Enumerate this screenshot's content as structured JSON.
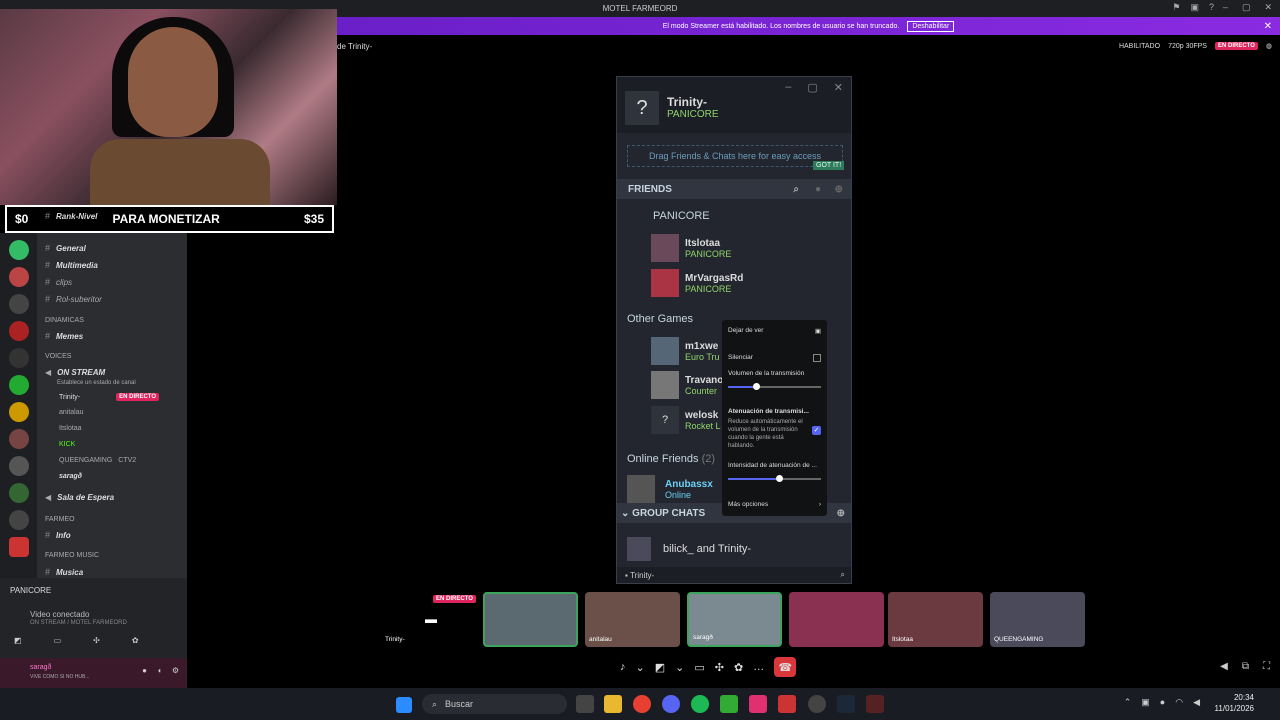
{
  "titlebar": {
    "title": "MOTEL FARMEORD"
  },
  "banner": {
    "text": "El modo Streamer está habilitado. Los nombres de usuario se han truncado.",
    "button": "Deshabilitar"
  },
  "header": {
    "channel": "de Trinity-",
    "enabled": "HABILITADO",
    "quality": "720p 30FPS",
    "live": "EN DIRECTO"
  },
  "overlay": {
    "left": "$0",
    "center": "PARA MONETIZAR",
    "right": "$35"
  },
  "sidebar": {
    "channels": [
      {
        "name": "Rank-Nivel",
        "type": "text"
      },
      {
        "name": "General",
        "type": "text"
      },
      {
        "name": "Multimedia",
        "type": "text"
      },
      {
        "name": "clips",
        "type": "text"
      },
      {
        "name": "Rol-suberitor",
        "type": "text"
      }
    ],
    "cat_dinamicas": "DINAMICAS",
    "memes": "Memes",
    "cat_voices": "VOICES",
    "on_stream": "ON STREAM",
    "on_stream_sub": "Establece un estado de canal",
    "members": [
      {
        "name": "Trinity-",
        "tag": "EN DIRECTO"
      },
      {
        "name": "anitalau"
      },
      {
        "name": "Itslotaa"
      },
      {
        "name": "KICK"
      },
      {
        "name": "QUEENGAMING",
        "tag": "CTV2"
      },
      {
        "name": "saragð"
      }
    ],
    "sala": "Sala de Espera",
    "cat_farmeo": "FARMEO",
    "info": "Info",
    "cat_music": "FARMEO MUSIC",
    "musica": "Musica",
    "server_name": "PANICORE",
    "video_status": "Video conectado",
    "video_sub": "ON STREAM / MOTEL FARMEORD",
    "user_name": "saragð",
    "user_status": "VIVE COMO SI NO HUB..."
  },
  "steam": {
    "user": "Trinity-",
    "game": "PANICORE",
    "drag": "Drag Friends & Chats here for easy access",
    "gotit": "GOT IT!",
    "friends": "FRIENDS",
    "group": "PANICORE",
    "friends_list": [
      {
        "name": "Itslotaa",
        "game": "PANICORE"
      },
      {
        "name": "MrVargasRd",
        "game": "PANICORE"
      }
    ],
    "other_games": "Other Games",
    "others": [
      {
        "name": "m1xwe",
        "game": "Euro Tru"
      },
      {
        "name": "Travano",
        "game": "Counter"
      },
      {
        "name": "welosk",
        "game": "Rocket L"
      }
    ],
    "online": "Online Friends",
    "online_count": "(2)",
    "online_first": "Anubassx",
    "online_first_status": "Online",
    "group_chats": "GROUP CHATS",
    "chat": "bilick_ and Trinity-",
    "bottom": "Trinity-"
  },
  "ctx": {
    "stop": "Dejar de ver",
    "mute": "Silenciar",
    "volume": "Volumen de la transmisión",
    "volume_level": 0.3,
    "atten": "Atenuación de transmisi...",
    "atten_desc": "Reduce automáticamente el volumen de la transmisión cuando la gente está hablando.",
    "intensity": "Intensidad de atenuación de ...",
    "intensity_level": 0.55,
    "more": "Más opciones"
  },
  "participants": [
    "Trinity-",
    "",
    "anitalau",
    "saragð",
    "",
    "Itslotaa",
    "QUEENGAMING"
  ],
  "participant_live": "EN DIRECTO",
  "taskbar": {
    "search": "Buscar",
    "time": "20:34",
    "date": "11/01/2026"
  }
}
